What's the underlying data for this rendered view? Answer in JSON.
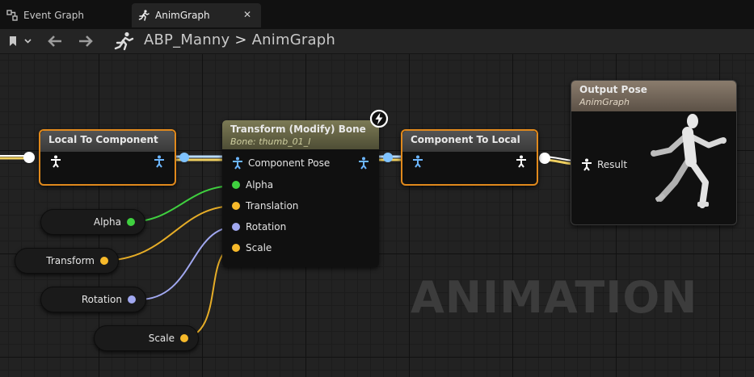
{
  "tabs": [
    {
      "label": "Event Graph",
      "icon": "event-graph-icon"
    },
    {
      "label": "AnimGraph",
      "icon": "running-man-icon",
      "close": "✕"
    }
  ],
  "breadcrumb": {
    "asset": "ABP_Manny",
    "separator": ">",
    "graph": "AnimGraph"
  },
  "nodes": {
    "local_to_component": {
      "title": "Local To Component"
    },
    "transform_modify_bone": {
      "title": "Transform (Modify) Bone",
      "subtitle": "Bone: thumb_01_l",
      "pins": [
        "Component Pose",
        "Alpha",
        "Translation",
        "Rotation",
        "Scale"
      ]
    },
    "component_to_local": {
      "title": "Component To Local"
    },
    "output_pose": {
      "title": "Output Pose",
      "subtitle": "AnimGraph",
      "pin": "Result"
    }
  },
  "variables": [
    {
      "label": "Alpha",
      "color": "#3fd03f"
    },
    {
      "label": "Transform",
      "color": "#f7b92a"
    },
    {
      "label": "Rotation",
      "color": "#a1a8f0"
    },
    {
      "label": "Scale",
      "color": "#f7b92a"
    }
  ],
  "watermark": "ANIMATION",
  "colors": {
    "selection": "#e0891c",
    "pose_pin": "#6cb6ff",
    "float_pin": "#3fd03f",
    "vector_pin": "#f7b92a",
    "rotator_pin": "#a1a8f0"
  }
}
